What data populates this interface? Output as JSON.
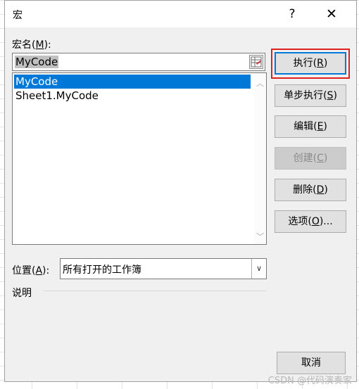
{
  "dialog": {
    "title": "宏",
    "help_label": "?",
    "close_label": "✕"
  },
  "macro_name": {
    "label_prefix": "宏名(",
    "label_key": "M",
    "label_suffix": "):",
    "value": "MyCode"
  },
  "macro_list": {
    "items": [
      {
        "label": "MyCode",
        "selected": true
      },
      {
        "label": "Sheet1.MyCode",
        "selected": false
      }
    ]
  },
  "buttons": {
    "run": {
      "text": "执行(",
      "key": "R",
      "end": ")"
    },
    "step": {
      "text": "单步执行(",
      "key": "S",
      "end": ")"
    },
    "edit": {
      "text": "编辑(",
      "key": "E",
      "end": ")"
    },
    "create": {
      "text": "创建(",
      "key": "C",
      "end": ")"
    },
    "delete": {
      "text": "删除(",
      "key": "D",
      "end": ")"
    },
    "options": {
      "text": "选项(",
      "key": "O",
      "end": ")..."
    },
    "cancel": {
      "text": "取消"
    }
  },
  "location": {
    "label_prefix": "位置(",
    "label_key": "A",
    "label_suffix": "):",
    "value": "所有打开的工作簿"
  },
  "description": {
    "label": "说明"
  },
  "watermark": "CSDN @代码演奏家",
  "colors": {
    "selection": "#0078d7",
    "highlight": "#e02020"
  }
}
